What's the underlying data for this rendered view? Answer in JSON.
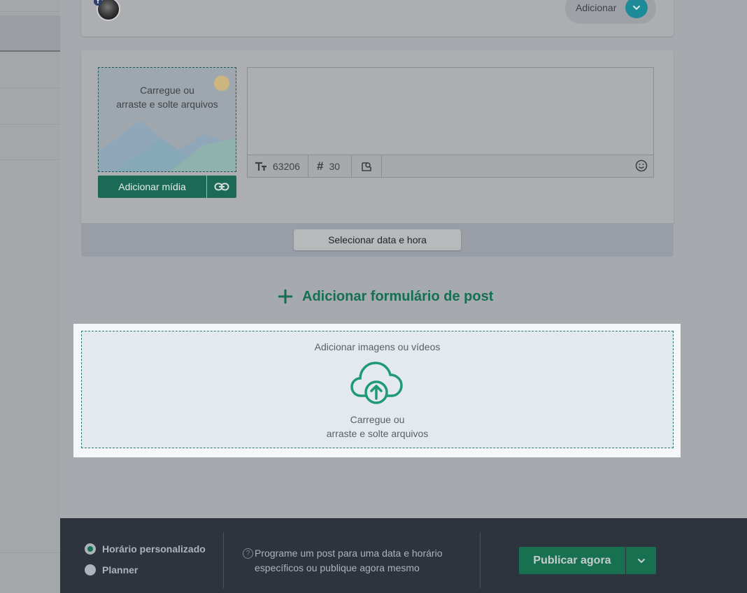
{
  "composer": {
    "add_pill_label": "Adicionar",
    "dropzone_small_text_line1": "Carregue ou",
    "dropzone_small_text_line2": "arraste e solte arquivos",
    "add_media_label": "Adicionar mídia",
    "char_count": "63206",
    "hashtag_count": "30",
    "select_date_label": "Selecionar data e hora"
  },
  "add_form_label": "Adicionar formulário de post",
  "media_dropzone": {
    "title": "Adicionar imagens ou vídeos",
    "hint_line1": "Carregue ou",
    "hint_line2": "arraste e solte arquivos"
  },
  "footer": {
    "option_custom": "Horário personalizado",
    "option_planner": "Planner",
    "selected_option": "Horário personalizado",
    "help_line1": "Programe um post para uma data e horário",
    "help_line2": "específicos ou publique agora mesmo",
    "publish_label": "Publicar agora"
  },
  "colors": {
    "accent_green": "#17704f",
    "accent_teal": "#1d8a97",
    "footer_bg": "#2d343d",
    "highlight_bg": "#f4f6f8"
  },
  "icons": [
    "facebook-badge-icon",
    "chevron-down-icon",
    "link-icon",
    "text-size-icon",
    "hashtag-icon",
    "image-search-icon",
    "emoji-icon",
    "plus-icon",
    "cloud-upload-icon",
    "help-icon"
  ]
}
